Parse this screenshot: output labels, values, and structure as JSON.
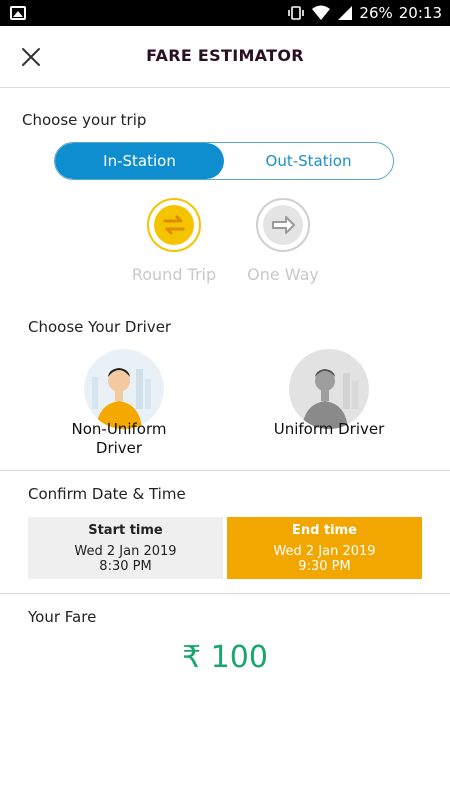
{
  "status_bar": {
    "battery": "26%",
    "time": "20:13"
  },
  "header": {
    "title": "FARE ESTIMATOR"
  },
  "trip": {
    "label": "Choose your trip",
    "tabs": [
      {
        "label": "In-Station",
        "active": true
      },
      {
        "label": "Out-Station",
        "active": false
      }
    ],
    "options": [
      {
        "label": "Round Trip",
        "icon": "round-trip-icon"
      },
      {
        "label": "One Way",
        "icon": "one-way-icon"
      }
    ]
  },
  "driver": {
    "label": "Choose Your Driver",
    "options": [
      {
        "label": "Non-Uniform Driver"
      },
      {
        "label": "Uniform Driver"
      }
    ]
  },
  "datetime": {
    "label": "Confirm Date & Time",
    "start": {
      "heading": "Start time",
      "date": "Wed 2 Jan 2019",
      "time": "8:30 PM"
    },
    "end": {
      "heading": "End time",
      "date": "Wed 2 Jan 2019",
      "time": "9:30 PM"
    }
  },
  "fare": {
    "label": "Your Fare",
    "amount": "₹ 100"
  },
  "colors": {
    "accent_blue": "#0f8ecf",
    "accent_orange": "#f2a700",
    "fare_green": "#1aa56c"
  }
}
